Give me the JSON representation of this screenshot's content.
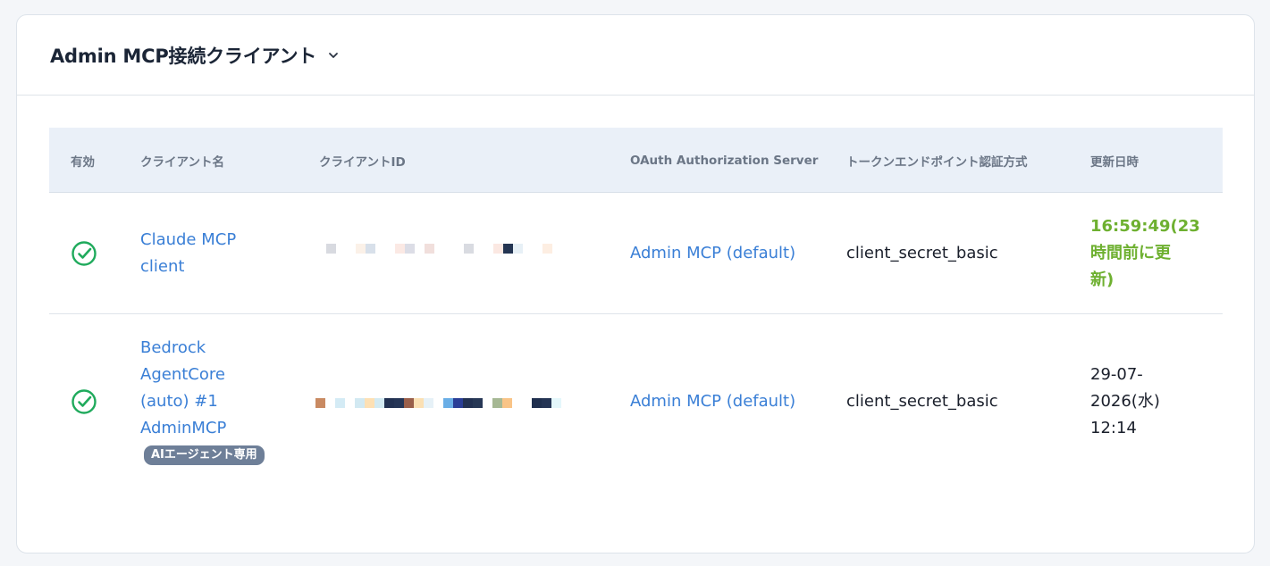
{
  "header": {
    "title": "Admin MCP接続クライアント"
  },
  "table": {
    "columns": [
      "有効",
      "クライアント名",
      "クライアントID",
      "OAuth Authorization Server",
      "トークンエンドポイント認証方式",
      "更新日時"
    ],
    "rows": [
      {
        "enabled": true,
        "name_lines": [
          "Claude MCP",
          "client"
        ],
        "badge": "",
        "auth_server": "Admin MCP (default)",
        "auth_method": "client_secret_basic",
        "updated_lines": [
          "16:59:49(23",
          "時間前に更",
          "新)"
        ],
        "updated_recent": true
      },
      {
        "enabled": true,
        "name_lines": [
          "Bedrock",
          "AgentCore",
          "(auto) #1",
          "AdminMCP"
        ],
        "badge": "AIエージェント専用",
        "auth_server": "Admin MCP (default)",
        "auth_method": "client_secret_basic",
        "updated_lines": [
          "29-07-",
          "2026(水)",
          "12:14"
        ],
        "updated_recent": false
      }
    ]
  },
  "colors": {
    "accent": "#3a7fd6",
    "success": "#1faa5c",
    "recent": "#6eb030",
    "badge": "#6e7f98"
  },
  "icons": {
    "enabled": "check-circle-icon",
    "dropdown": "chevron-down-icon"
  }
}
